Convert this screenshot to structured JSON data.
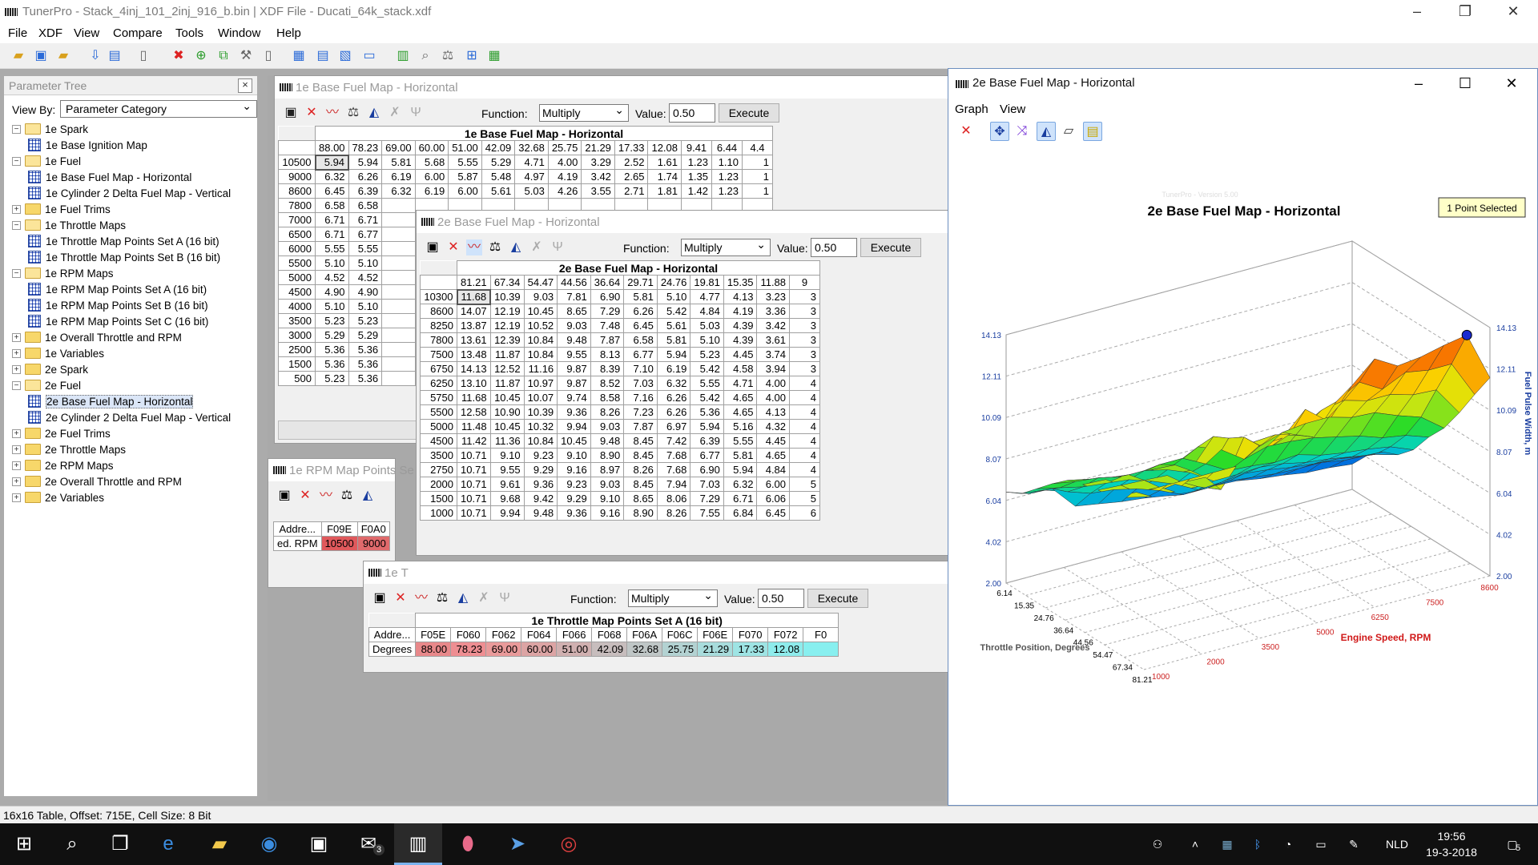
{
  "app": {
    "title": "TunerPro - Stack_4inj_101_2inj_916_b.bin | XDF File - Ducati_64k_stack.xdf",
    "menu": [
      "File",
      "XDF",
      "View",
      "Compare",
      "Tools",
      "Window",
      "Help"
    ]
  },
  "tree": {
    "header": "Parameter Tree",
    "view_by_label": "View By:",
    "view_by_value": "Parameter Category",
    "nodes": [
      {
        "label": "1e Spark",
        "level": 0,
        "type": "folder",
        "expanded": true
      },
      {
        "label": "1e Base Ignition Map",
        "level": 1,
        "type": "table"
      },
      {
        "label": "1e Fuel",
        "level": 0,
        "type": "folder",
        "expanded": true
      },
      {
        "label": "1e Base Fuel Map - Horizontal",
        "level": 1,
        "type": "table"
      },
      {
        "label": "1e Cylinder 2 Delta Fuel Map - Vertical",
        "level": 1,
        "type": "table"
      },
      {
        "label": "1e Fuel Trims",
        "level": 0,
        "type": "folder",
        "expanded": false
      },
      {
        "label": "1e Throttle Maps",
        "level": 0,
        "type": "folder",
        "expanded": true
      },
      {
        "label": "1e Throttle Map Points Set A (16 bit)",
        "level": 1,
        "type": "table"
      },
      {
        "label": "1e Throttle Map Points Set B (16 bit)",
        "level": 1,
        "type": "table"
      },
      {
        "label": "1e RPM Maps",
        "level": 0,
        "type": "folder",
        "expanded": true
      },
      {
        "label": "1e RPM Map Points Set A (16 bit)",
        "level": 1,
        "type": "table"
      },
      {
        "label": "1e RPM Map Points Set B (16 bit)",
        "level": 1,
        "type": "table"
      },
      {
        "label": "1e RPM Map Points Set C (16 bit)",
        "level": 1,
        "type": "table"
      },
      {
        "label": "1e Overall Throttle and RPM",
        "level": 0,
        "type": "folder",
        "expanded": false
      },
      {
        "label": "1e Variables",
        "level": 0,
        "type": "folder",
        "expanded": false
      },
      {
        "label": "2e Spark",
        "level": 0,
        "type": "folder",
        "expanded": false
      },
      {
        "label": "2e Fuel",
        "level": 0,
        "type": "folder",
        "expanded": true
      },
      {
        "label": "2e Base Fuel Map - Horizontal",
        "level": 1,
        "type": "table",
        "selected": true
      },
      {
        "label": "2e Cylinder 2 Delta Fuel Map - Vertical",
        "level": 1,
        "type": "table"
      },
      {
        "label": "2e Fuel Trims",
        "level": 0,
        "type": "folder",
        "expanded": false
      },
      {
        "label": "2e Throttle Maps",
        "level": 0,
        "type": "folder",
        "expanded": false
      },
      {
        "label": "2e RPM Maps",
        "level": 0,
        "type": "folder",
        "expanded": false
      },
      {
        "label": "2e Overall Throttle and RPM",
        "level": 0,
        "type": "folder",
        "expanded": false
      },
      {
        "label": "2e Variables",
        "level": 0,
        "type": "folder",
        "expanded": false
      }
    ]
  },
  "func": {
    "label": "Function:",
    "value": "Multiply",
    "value_label": "Value:",
    "number": "0.50",
    "execute": "Execute"
  },
  "win1e": {
    "title": "1e Base Fuel Map - Horizontal",
    "caption": "1e Base Fuel Map - Horizontal",
    "cols": [
      "88.00",
      "78.23",
      "69.00",
      "60.00",
      "51.00",
      "42.09",
      "32.68",
      "25.75",
      "21.29",
      "17.33",
      "12.08",
      "9.41",
      "6.44",
      "4.4"
    ],
    "rows": [
      {
        "h": "10500",
        "v": [
          "5.94",
          "5.94",
          "5.81",
          "5.68",
          "5.55",
          "5.29",
          "4.71",
          "4.00",
          "3.29",
          "2.52",
          "1.61",
          "1.23",
          "1.10",
          "1"
        ]
      },
      {
        "h": "9000",
        "v": [
          "6.32",
          "6.26",
          "6.19",
          "6.00",
          "5.87",
          "5.48",
          "4.97",
          "4.19",
          "3.42",
          "2.65",
          "1.74",
          "1.35",
          "1.23",
          "1"
        ]
      },
      {
        "h": "8600",
        "v": [
          "6.45",
          "6.39",
          "6.32",
          "6.19",
          "6.00",
          "5.61",
          "5.03",
          "4.26",
          "3.55",
          "2.71",
          "1.81",
          "1.42",
          "1.23",
          "1"
        ]
      },
      {
        "h": "7800",
        "v": [
          "6.58",
          "6.58"
        ]
      },
      {
        "h": "7000",
        "v": [
          "6.71",
          "6.71"
        ]
      },
      {
        "h": "6500",
        "v": [
          "6.71",
          "6.77"
        ]
      },
      {
        "h": "6000",
        "v": [
          "5.55",
          "5.55"
        ]
      },
      {
        "h": "5500",
        "v": [
          "5.10",
          "5.10"
        ]
      },
      {
        "h": "5000",
        "v": [
          "4.52",
          "4.52"
        ]
      },
      {
        "h": "4500",
        "v": [
          "4.90",
          "4.90"
        ]
      },
      {
        "h": "4000",
        "v": [
          "5.10",
          "5.10"
        ]
      },
      {
        "h": "3500",
        "v": [
          "5.23",
          "5.23"
        ]
      },
      {
        "h": "3000",
        "v": [
          "5.29",
          "5.29"
        ]
      },
      {
        "h": "2500",
        "v": [
          "5.36",
          "5.36"
        ]
      },
      {
        "h": "1500",
        "v": [
          "5.36",
          "5.36"
        ]
      },
      {
        "h": "500",
        "v": [
          "5.23",
          "5.36"
        ]
      }
    ]
  },
  "win2e": {
    "title": "2e Base Fuel Map - Horizontal",
    "caption": "2e Base Fuel Map - Horizontal",
    "cols": [
      "81.21",
      "67.34",
      "54.47",
      "44.56",
      "36.64",
      "29.71",
      "24.76",
      "19.81",
      "15.35",
      "11.88",
      "9"
    ],
    "rows": [
      {
        "h": "10300",
        "v": [
          "11.68",
          "10.39",
          "9.03",
          "7.81",
          "6.90",
          "5.81",
          "5.10",
          "4.77",
          "4.13",
          "3.23",
          "3"
        ]
      },
      {
        "h": "8600",
        "v": [
          "14.07",
          "12.19",
          "10.45",
          "8.65",
          "7.29",
          "6.26",
          "5.42",
          "4.84",
          "4.19",
          "3.36",
          "3"
        ]
      },
      {
        "h": "8250",
        "v": [
          "13.87",
          "12.19",
          "10.52",
          "9.03",
          "7.48",
          "6.45",
          "5.61",
          "5.03",
          "4.39",
          "3.42",
          "3"
        ]
      },
      {
        "h": "7800",
        "v": [
          "13.61",
          "12.39",
          "10.84",
          "9.48",
          "7.87",
          "6.58",
          "5.81",
          "5.10",
          "4.39",
          "3.61",
          "3"
        ]
      },
      {
        "h": "7500",
        "v": [
          "13.48",
          "11.87",
          "10.84",
          "9.55",
          "8.13",
          "6.77",
          "5.94",
          "5.23",
          "4.45",
          "3.74",
          "3"
        ]
      },
      {
        "h": "6750",
        "v": [
          "14.13",
          "12.52",
          "11.16",
          "9.87",
          "8.39",
          "7.10",
          "6.19",
          "5.42",
          "4.58",
          "3.94",
          "3"
        ]
      },
      {
        "h": "6250",
        "v": [
          "13.10",
          "11.87",
          "10.97",
          "9.87",
          "8.52",
          "7.03",
          "6.32",
          "5.55",
          "4.71",
          "4.00",
          "4"
        ]
      },
      {
        "h": "5750",
        "v": [
          "11.68",
          "10.45",
          "10.07",
          "9.74",
          "8.58",
          "7.16",
          "6.26",
          "5.42",
          "4.65",
          "4.00",
          "4"
        ]
      },
      {
        "h": "5500",
        "v": [
          "12.58",
          "10.90",
          "10.39",
          "9.36",
          "8.26",
          "7.23",
          "6.26",
          "5.36",
          "4.65",
          "4.13",
          "4"
        ]
      },
      {
        "h": "5000",
        "v": [
          "11.48",
          "10.45",
          "10.32",
          "9.94",
          "9.03",
          "7.87",
          "6.97",
          "5.94",
          "5.16",
          "4.32",
          "4"
        ]
      },
      {
        "h": "4500",
        "v": [
          "11.42",
          "11.36",
          "10.84",
          "10.45",
          "9.48",
          "8.45",
          "7.42",
          "6.39",
          "5.55",
          "4.45",
          "4"
        ]
      },
      {
        "h": "3500",
        "v": [
          "10.71",
          "9.10",
          "9.23",
          "9.10",
          "8.90",
          "8.45",
          "7.68",
          "6.77",
          "5.81",
          "4.65",
          "4"
        ]
      },
      {
        "h": "2750",
        "v": [
          "10.71",
          "9.55",
          "9.29",
          "9.16",
          "8.97",
          "8.26",
          "7.68",
          "6.90",
          "5.94",
          "4.84",
          "4"
        ]
      },
      {
        "h": "2000",
        "v": [
          "10.71",
          "9.61",
          "9.36",
          "9.23",
          "9.03",
          "8.45",
          "7.94",
          "7.03",
          "6.32",
          "6.00",
          "5"
        ]
      },
      {
        "h": "1500",
        "v": [
          "10.71",
          "9.68",
          "9.42",
          "9.29",
          "9.10",
          "8.65",
          "8.06",
          "7.29",
          "6.71",
          "6.06",
          "5"
        ]
      },
      {
        "h": "1000",
        "v": [
          "10.71",
          "9.94",
          "9.48",
          "9.36",
          "9.16",
          "8.90",
          "8.26",
          "7.55",
          "6.84",
          "6.45",
          "6"
        ]
      }
    ]
  },
  "winrpm": {
    "title": "1e RPM Map Points Se",
    "addr_label": "Addre...",
    "row_label": "ed. RPM",
    "cols": [
      "F09E",
      "F0A0"
    ],
    "vals": [
      "10500",
      "9000"
    ]
  },
  "winthr": {
    "title": "1e T",
    "caption": "1e Throttle Map Points Set A (16 bit)",
    "addr_label": "Addre...",
    "row_label": "Degrees",
    "cols": [
      "F05E",
      "F060",
      "F062",
      "F064",
      "F066",
      "F068",
      "F06A",
      "F06C",
      "F06E",
      "F070",
      "F072",
      "F0"
    ],
    "vals": [
      "88.00",
      "78.23",
      "69.00",
      "60.00",
      "51.00",
      "42.09",
      "32.68",
      "25.75",
      "21.29",
      "17.33",
      "12.08",
      ""
    ],
    "colors": [
      "#e8888a",
      "#ee8e92",
      "#e99a9a",
      "#dca4a4",
      "#d0b0b0",
      "#c7bdbd",
      "#bfc6c6",
      "#b3d2d2",
      "#a8dcdc",
      "#9ee4e4",
      "#8eecec",
      "#88efef"
    ]
  },
  "graph": {
    "title": "2e Base Fuel Map - Horizontal",
    "menu": [
      "Graph",
      "View"
    ],
    "watermark": "TunerPro - Version 5.00",
    "selected_badge": "1 Point Selected",
    "chart_title": "2e Base Fuel Map - Horizontal",
    "left_ticks": [
      "14.13",
      "12.11",
      "10.09",
      "8.07",
      "6.04",
      "4.02",
      "2.00"
    ],
    "right_ticks": [
      "14.13",
      "12.11",
      "10.09",
      "8.07",
      "6.04",
      "4.02",
      "2.00"
    ],
    "x_ticks": [
      "6.14",
      "15.35",
      "24.76",
      "36.64",
      "44.56",
      "54.47",
      "67.34",
      "81.21"
    ],
    "rpm_ticks": [
      "1000",
      "2000",
      "3500",
      "5000",
      "6250",
      "7500",
      "8600"
    ],
    "xlabel": "Throttle Position, Degrees",
    "ylabel": "Engine Speed, RPM",
    "zlabel": "Fuel Pulse Width, m"
  },
  "status": {
    "text": "16x16 Table, Offset: 715E,  Cell Size: 8 Bit"
  },
  "taskbar": {
    "lang": "NLD",
    "time": "19:56",
    "date": "19-3-2018",
    "mail_badge": "3",
    "notif": "5"
  },
  "colors": {
    "selected_red": "#e0595c",
    "cell_highlight": "#e7e7e7",
    "accent": "#1e5fc4"
  }
}
